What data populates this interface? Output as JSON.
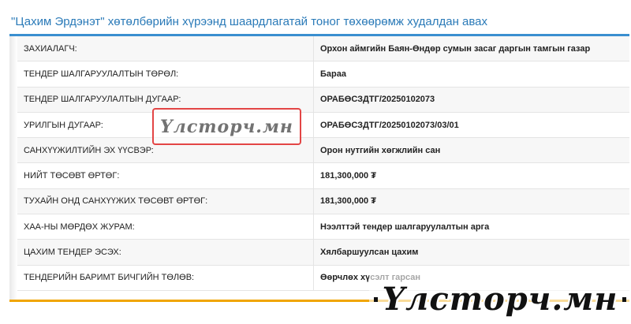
{
  "page": {
    "title": "\"Цахим Эрдэнэт\" хөтөлбөрийн хүрээнд шаардлагатай тоног төхөөрөмж худалдан авах"
  },
  "details": {
    "rows": [
      {
        "label": "ЗАХИАЛАГЧ:",
        "value": "Орхон аймгийн Баян-Өндөр сумын засаг даргын тамгын газар"
      },
      {
        "label": "ТЕНДЕР ШАЛГАРУУЛАЛТЫН ТӨРӨЛ:",
        "value": "Бараа"
      },
      {
        "label": "ТЕНДЕР ШАЛГАРУУЛАЛТЫН ДУГААР:",
        "value": "ОРАБӨСЗДТГ/20250102073"
      },
      {
        "label": "УРИЛГЫН ДУГААР:",
        "value": "ОРАБӨСЗДТГ/20250102073/03/01"
      },
      {
        "label": "САНХҮҮЖИЛТИЙН ЭХ ҮҮСВЭР:",
        "value": "Орон нутгийн хөгжлийн сан"
      },
      {
        "label": "НИЙТ ТӨСӨВТ ӨРТӨГ:",
        "value": "181,300,000 ₮"
      },
      {
        "label": "ТУХАЙН ОНД САНХҮҮЖИХ ТӨСӨВТ ӨРТӨГ:",
        "value": "181,300,000 ₮"
      },
      {
        "label": "ХАА-НЫ МӨРДӨХ ЖУРАМ:",
        "value": "Нээлттэй тендер шалгаруулалтын арга"
      },
      {
        "label": "ЦАХИМ ТЕНДЕР ЭСЭХ:",
        "value": "Хялбаршуулсан цахим"
      },
      {
        "label": "ТЕНДЕРИЙН БАРИМТ БИЧГИЙН ТӨЛӨВ:",
        "value": "Өөрчлөх хүсэлт гарсан"
      }
    ]
  },
  "watermark": {
    "text": "Үлсторч.мн"
  }
}
